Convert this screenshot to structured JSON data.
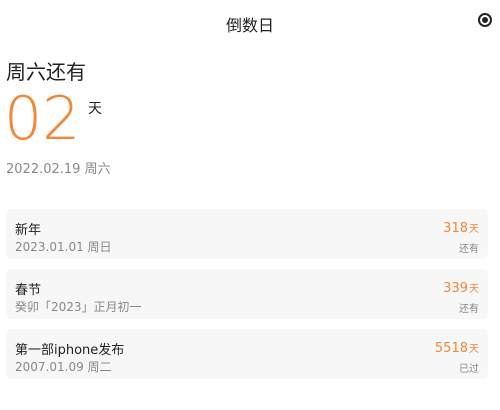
{
  "nav": {
    "title": "倒数日",
    "record_icon": "record-target-icon"
  },
  "hero": {
    "caption": "周六还有",
    "days": "02",
    "unit": "天",
    "date": "2022.02.19 周六",
    "accent_color": "#f2873a"
  },
  "events": [
    {
      "title": "新年",
      "date": "2023.01.01 周日",
      "days": "318",
      "unit": "天",
      "status": "还有"
    },
    {
      "title": "春节",
      "date": "癸卯「2023」正月初一",
      "days": "339",
      "unit": "天",
      "status": "还有"
    },
    {
      "title": "第一部iphone发布",
      "date": "2007.01.09 周二",
      "days": "5518",
      "unit": "天",
      "status": "已过"
    }
  ]
}
